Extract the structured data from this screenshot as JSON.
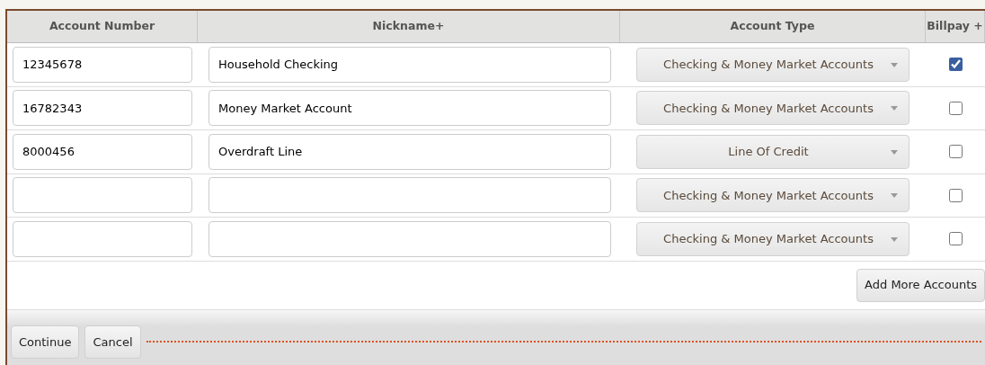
{
  "table": {
    "columns": [
      "Account Number",
      "Nickname+",
      "Account Type",
      "Billpay +"
    ],
    "rows": [
      {
        "account_number": "12345678",
        "nickname": "Household Checking",
        "account_type": "Checking & Money Market Accounts",
        "billpay": true
      },
      {
        "account_number": "16782343",
        "nickname": "Money Market Account",
        "account_type": "Checking & Money Market Accounts",
        "billpay": false
      },
      {
        "account_number": "8000456",
        "nickname": "Overdraft Line",
        "account_type": "Line Of Credit",
        "billpay": false
      },
      {
        "account_number": "",
        "nickname": "",
        "account_type": "Checking & Money Market Accounts",
        "billpay": false
      },
      {
        "account_number": "",
        "nickname": "",
        "account_type": "Checking & Money Market Accounts",
        "billpay": false
      }
    ]
  },
  "add_button": "Add More Accounts",
  "footer_buttons": [
    "Continue",
    "Cancel"
  ]
}
